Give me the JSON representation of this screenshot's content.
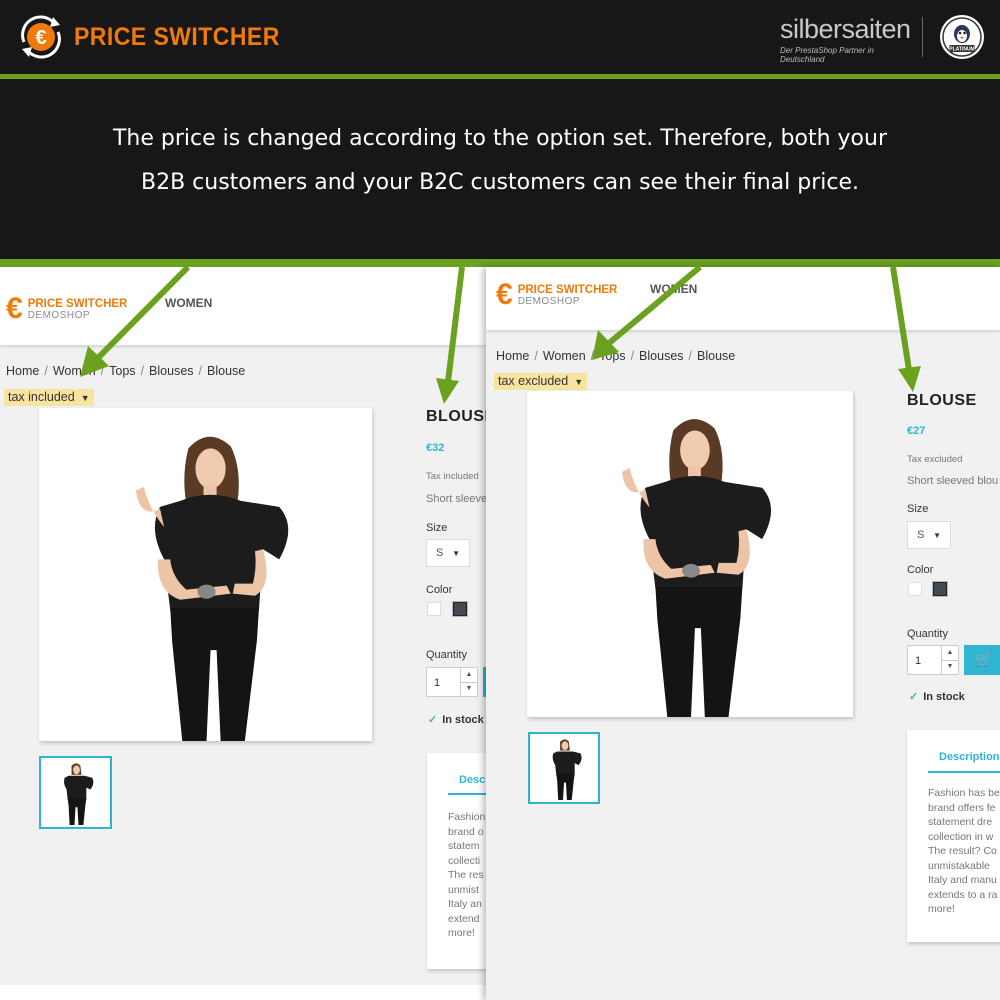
{
  "banner": {
    "brand_title": "PRICE SWITCHER",
    "partner_name": "silbersaiten",
    "partner_subtitle": "Der PrestaShop Partner in Deutschland",
    "badge_label": "PLATINUM"
  },
  "caption": {
    "line1": "The price is changed according to the option set. Therefore, both your",
    "line2": "B2B customers and your B2C customers can see their final price."
  },
  "shops": {
    "left": {
      "logo_title": "PRICE SWITCHER",
      "logo_sub": "DEMOSHOP",
      "nav_item": "WOMEN",
      "breadcrumb": [
        "Home",
        "Women",
        "Tops",
        "Blouses",
        "Blouse"
      ],
      "tax_option": "tax included",
      "product_title": "BLOUSE",
      "price": "€32",
      "tax_note": "Tax included",
      "short_desc": "Short sleeve",
      "size_label": "Size",
      "size_value": "S",
      "color_label": "Color",
      "quantity_label": "Quantity",
      "quantity_value": "1",
      "stock": "In stock",
      "desc_tab": "Desc",
      "desc_lines": [
        "Fashion",
        "brand o",
        "statem",
        "collecti",
        "The res",
        "unmist",
        "Italy an",
        "extend",
        "more!"
      ]
    },
    "right": {
      "logo_title": "PRICE SWITCHER",
      "logo_sub": "DEMOSHOP",
      "nav_item": "WOMEN",
      "breadcrumb": [
        "Home",
        "Women",
        "Tops",
        "Blouses",
        "Blouse"
      ],
      "tax_option": "tax excluded",
      "product_title": "BLOUSE",
      "price": "€27",
      "tax_note": "Tax excluded",
      "short_desc": "Short sleeved blou",
      "size_label": "Size",
      "size_value": "S",
      "color_label": "Color",
      "quantity_label": "Quantity",
      "quantity_value": "1",
      "stock": "In stock",
      "desc_tab": "Description",
      "desc_lines": [
        "Fashion has be",
        "brand offers fe",
        "statement dre",
        "collection in w",
        "The result? Co",
        "unmistakable",
        "Italy and manu",
        "extends to a ra",
        "more!"
      ]
    }
  },
  "colors": {
    "brand_orange": "#f07a0a",
    "accent_green": "#6aa11f",
    "shop_blue": "#2fb5d2",
    "tax_highlight": "#f8e3a1",
    "dark_bg": "#171717"
  },
  "icons": [
    "euro-refresh-icon",
    "cart-icon",
    "check-icon",
    "caret-down-icon",
    "stepper-up-icon",
    "stepper-down-icon",
    "pointer-arrow-icon"
  ]
}
